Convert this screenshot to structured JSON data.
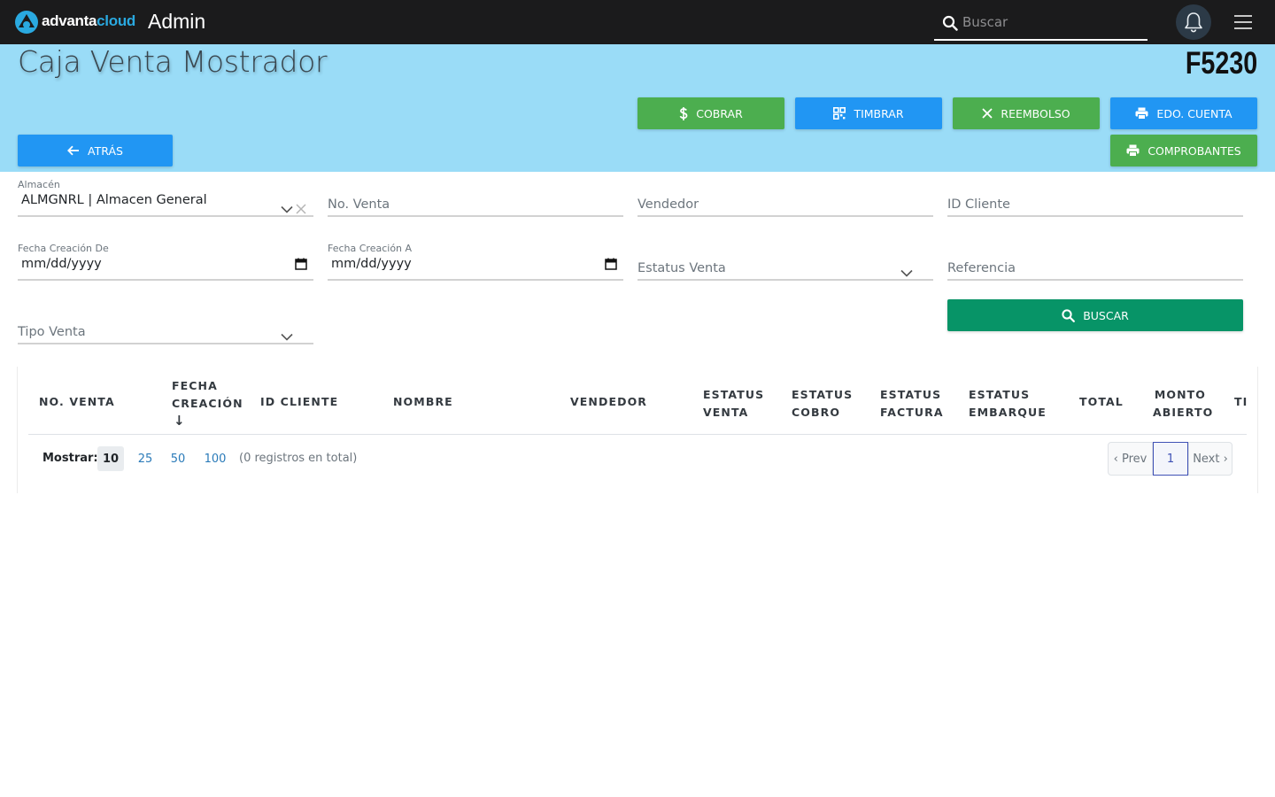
{
  "topbar": {
    "brand_part1": "advanta",
    "brand_part2": "cloud",
    "app_title": "Admin",
    "search_placeholder": "Buscar",
    "icons": [
      "advanta-logo-icon",
      "search-icon",
      "bell-icon",
      "hamburger-menu-icon"
    ]
  },
  "header": {
    "title": "Caja Venta Mostrador",
    "form_code": "F5230",
    "background": "#9adcf7"
  },
  "actions": {
    "cobrar": "COBRAR",
    "timbrar": "TIMBRAR",
    "reembolso": "REEMBOLSO",
    "edo_cuenta": "EDO. CUENTA",
    "comprobantes": "COMPROBANTES",
    "atras": "ATRÁS"
  },
  "colors": {
    "green": "#4cae4f",
    "blue": "#2196f3",
    "search_button": "#079467",
    "topbar": "#1b1b1c"
  },
  "filters": {
    "almacen_label": "Almacén",
    "almacen_value": "ALMGNRL | Almacen General",
    "no_venta": "No. Venta",
    "vendedor": "Vendedor",
    "id_cliente": "ID Cliente",
    "fecha_de_label": "Fecha Creación De",
    "fecha_de_value": "mm/dd/yyyy",
    "fecha_a_label": "Fecha Creación A",
    "fecha_a_value": "mm/dd/yyyy",
    "estatus_venta": "Estatus Venta",
    "referencia": "Referencia",
    "tipo_venta": "Tipo Venta",
    "buscar": "BUSCAR"
  },
  "table": {
    "headers": {
      "no_venta": "NO. VENTA",
      "fecha_1": "FECHA",
      "fecha_2": "CREACIÓN",
      "sort_arrow": "↓",
      "id_cliente": "ID CLIENTE",
      "nombre": "NOMBRE",
      "vendedor": "VENDEDOR",
      "est_venta_1": "ESTATUS",
      "est_venta_2": "VENTA",
      "est_cobro_1": "ESTATUS",
      "est_cobro_2": "COBRO",
      "est_factura_1": "ESTATUS",
      "est_factura_2": "FACTURA",
      "est_embarque_1": "ESTATUS",
      "est_embarque_2": "EMBARQUE",
      "total": "TOTAL",
      "monto_1": "MONTO",
      "monto_2": "ABIERTO",
      "tipo_partial": "TI"
    },
    "rows": [],
    "sort_column": "FECHA CREACIÓN",
    "sort_direction": "descending"
  },
  "pagination": {
    "mostrar_label": "Mostrar:",
    "page_sizes": [
      "10",
      "25",
      "50",
      "100"
    ],
    "selected_size": "10",
    "records_text": "(0 registros en total)",
    "prev": "‹ Prev",
    "current": "1",
    "next": "Next ›"
  }
}
